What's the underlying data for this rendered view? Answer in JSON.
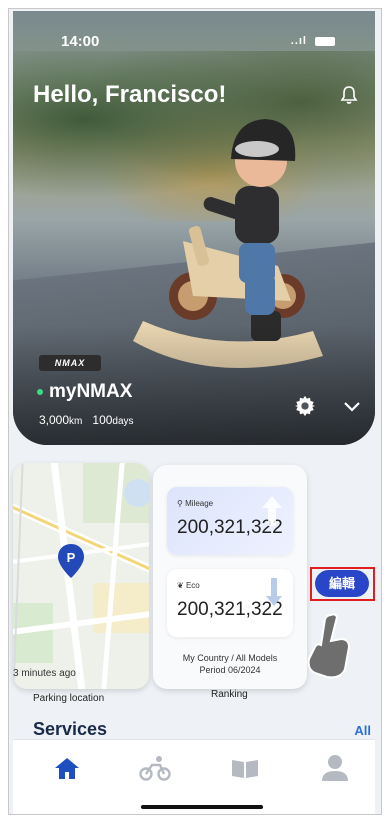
{
  "status_bar": {
    "time": "14:00",
    "signal": "..ıl"
  },
  "header": {
    "greeting": "Hello, Francisco!"
  },
  "bike": {
    "brand": "NMAX",
    "name": "myNMAX",
    "km_value": "3,000",
    "km_unit": "km",
    "days_value": "100",
    "days_unit": "days",
    "online_color": "#3ddc84"
  },
  "parking": {
    "time_ago": "3 minutes ago",
    "label": "Parking location"
  },
  "ranking": {
    "mileage_label": "Mileage",
    "mileage_value": "200,321,322",
    "eco_label": "Eco",
    "eco_value": "200,321,322",
    "scope": "My Country / All Models",
    "period": "Period 06/2024",
    "label": "Ranking"
  },
  "edit_button": {
    "label": "編輯",
    "highlight_color": "#e21d1d"
  },
  "services": {
    "title": "Services",
    "all_link": "All"
  },
  "tabs": {
    "items": [
      "home-icon",
      "bike-icon",
      "book-icon",
      "profile-icon"
    ],
    "active_color": "#1f4fbf",
    "inactive_color": "#b4b9c2"
  },
  "accent": "#2a46c8"
}
